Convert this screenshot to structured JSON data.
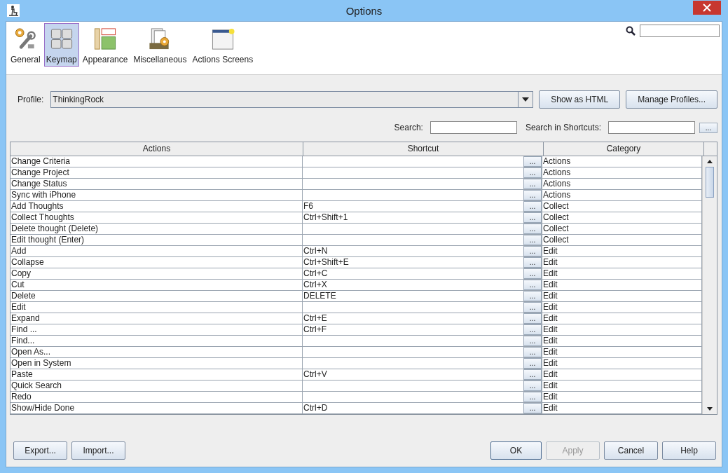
{
  "window": {
    "title": "Options"
  },
  "tabs": [
    {
      "label": "General",
      "selected": false,
      "kind": "general"
    },
    {
      "label": "Keymap",
      "selected": true,
      "kind": "keymap"
    },
    {
      "label": "Appearance",
      "selected": false,
      "kind": "appearance"
    },
    {
      "label": "Miscellaneous",
      "selected": false,
      "kind": "misc"
    },
    {
      "label": "Actions Screens",
      "selected": false,
      "kind": "screens"
    }
  ],
  "profile": {
    "label": "Profile:",
    "value": "ThinkingRock",
    "buttons": [
      "Show as HTML",
      "Manage Profiles..."
    ]
  },
  "search": {
    "label": "Search:",
    "shortcuts_label": "Search in Shortcuts:",
    "more_button": "..."
  },
  "table": {
    "columns": [
      "Actions",
      "Shortcut",
      "Category"
    ],
    "rows": [
      {
        "action": "Change Criteria",
        "button": "...",
        "category": "Actions"
      },
      {
        "action": "Change Project",
        "button": "...",
        "category": "Actions"
      },
      {
        "action": "Change Status",
        "button": "...",
        "category": "Actions"
      },
      {
        "action": "Sync with iPhone",
        "button": "...",
        "category": "Actions"
      },
      {
        "action": "Add Thoughts",
        "shortcut": "F6",
        "button": "...",
        "category": "Collect"
      },
      {
        "action": "Collect Thoughts",
        "shortcut": "Ctrl+Shift+1",
        "button": "...",
        "category": "Collect"
      },
      {
        "action": "Delete thought (Delete)",
        "button": "...",
        "category": "Collect"
      },
      {
        "action": "Edit thought (Enter)",
        "button": "...",
        "category": "Collect"
      },
      {
        "action": "Add",
        "shortcut": "Ctrl+N",
        "button": "...",
        "category": "Edit"
      },
      {
        "action": "Collapse",
        "shortcut": "Ctrl+Shift+E",
        "button": "...",
        "category": "Edit"
      },
      {
        "action": "Copy",
        "shortcut": "Ctrl+C",
        "button": "...",
        "category": "Edit"
      },
      {
        "action": "Cut",
        "shortcut": "Ctrl+X",
        "button": "...",
        "category": "Edit"
      },
      {
        "action": "Delete",
        "shortcut": "DELETE",
        "button": "...",
        "category": "Edit"
      },
      {
        "action": "Edit",
        "button": "...",
        "category": "Edit"
      },
      {
        "action": "Expand",
        "shortcut": "Ctrl+E",
        "button": "...",
        "category": "Edit"
      },
      {
        "action": "Find ...",
        "shortcut": "Ctrl+F",
        "button": "...",
        "category": "Edit"
      },
      {
        "action": "Find...",
        "button": "...",
        "category": "Edit"
      },
      {
        "action": "Open As...",
        "button": "...",
        "category": "Edit"
      },
      {
        "action": "Open in System",
        "button": "...",
        "category": "Edit"
      },
      {
        "action": "Paste",
        "shortcut": "Ctrl+V",
        "button": "...",
        "category": "Edit"
      },
      {
        "action": "Quick Search",
        "button": "...",
        "category": "Edit"
      },
      {
        "action": "Redo",
        "button": "...",
        "category": "Edit"
      },
      {
        "action": "Show/Hide Done",
        "shortcut": "Ctrl+D",
        "button": "...",
        "category": "Edit"
      }
    ]
  },
  "footer": {
    "left_buttons": [
      {
        "label": "Export...",
        "disabled": false
      },
      {
        "label": "Import...",
        "disabled": false
      }
    ],
    "right_buttons": [
      {
        "label": "OK",
        "disabled": false
      },
      {
        "label": "Apply",
        "disabled": true
      },
      {
        "label": "Cancel",
        "disabled": false
      },
      {
        "label": "Help",
        "disabled": false
      }
    ]
  }
}
